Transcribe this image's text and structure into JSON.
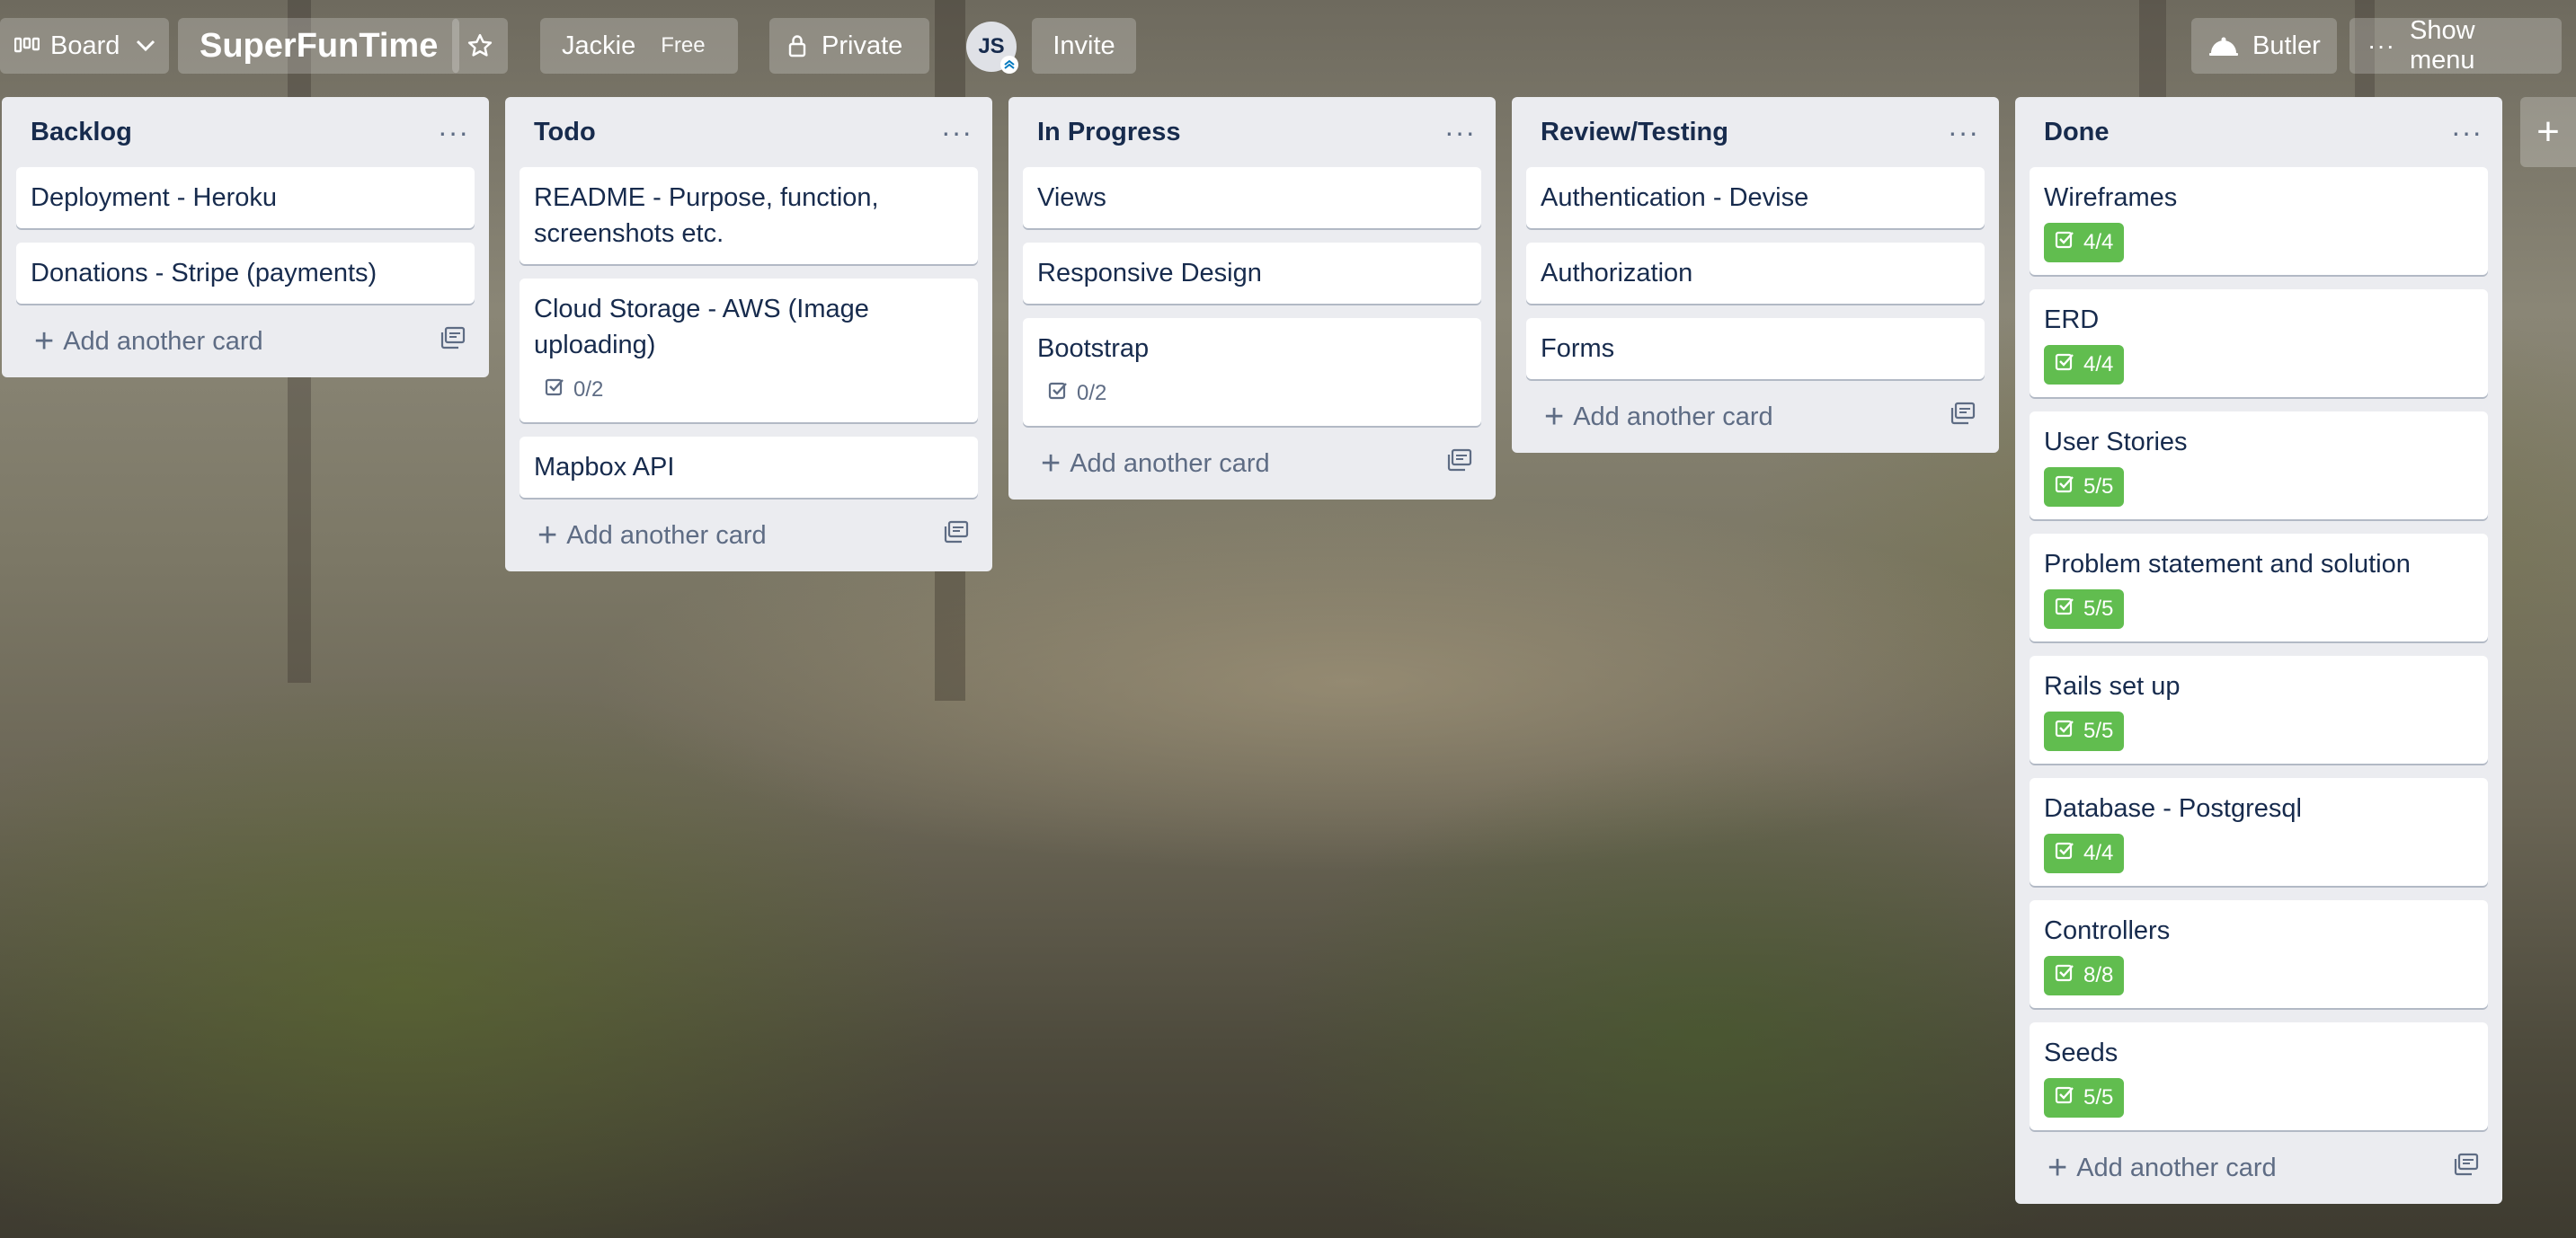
{
  "header": {
    "view_switcher_label": "Board",
    "board_title": "SuperFunTime",
    "team_name": "Jackie",
    "plan_badge": "Free",
    "visibility_label": "Private",
    "member_initials": "JS",
    "invite_label": "Invite",
    "butler_label": "Butler",
    "show_menu_label": "Show menu"
  },
  "add_card_label": "Add another card",
  "lists": [
    {
      "title": "Backlog",
      "cards": [
        {
          "title": "Deployment - Heroku"
        },
        {
          "title": "Donations - Stripe (payments)"
        }
      ]
    },
    {
      "title": "Todo",
      "cards": [
        {
          "title": "README - Purpose, function, screenshots etc."
        },
        {
          "title": "Cloud Storage - AWS (Image uploading)",
          "checklist": "0/2"
        },
        {
          "title": "Mapbox API"
        }
      ]
    },
    {
      "title": "In Progress",
      "cards": [
        {
          "title": "Views"
        },
        {
          "title": "Responsive Design"
        },
        {
          "title": "Bootstrap",
          "checklist": "0/2"
        }
      ]
    },
    {
      "title": "Review/Testing",
      "cards": [
        {
          "title": "Authentication - Devise"
        },
        {
          "title": "Authorization"
        },
        {
          "title": "Forms"
        }
      ]
    },
    {
      "title": "Done",
      "cards": [
        {
          "title": "Wireframes",
          "checklist": "4/4",
          "complete": true
        },
        {
          "title": "ERD",
          "checklist": "4/4",
          "complete": true
        },
        {
          "title": "User Stories",
          "checklist": "5/5",
          "complete": true
        },
        {
          "title": "Problem statement and solution",
          "checklist": "5/5",
          "complete": true
        },
        {
          "title": "Rails set up",
          "checklist": "5/5",
          "complete": true
        },
        {
          "title": "Database - Postgresql",
          "checklist": "4/4",
          "complete": true
        },
        {
          "title": "Controllers",
          "checklist": "8/8",
          "complete": true
        },
        {
          "title": "Seeds",
          "checklist": "5/5",
          "complete": true
        }
      ]
    }
  ],
  "colors": {
    "list_bg": "#ebecf0",
    "complete_badge": "#61bd4f",
    "text": "#172b4d",
    "muted": "#5e6c84"
  }
}
